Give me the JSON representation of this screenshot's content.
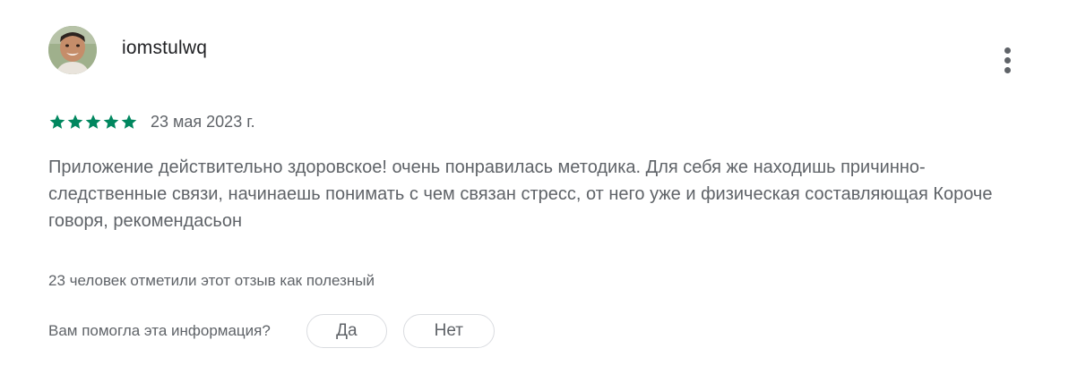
{
  "review": {
    "username": "iomstulwq",
    "rating": 5,
    "rating_max": 5,
    "date": "23 мая 2023 г.",
    "text": "Приложение действительно здоровское! очень понравилась методика. Для себя же находишь причинно-следственные связи, начинаешь понимать с чем связан стресс, от него уже и физическая составляющая Короче говоря, рекомендасьон",
    "helpful_count_text": "23 человек отметили этот отзыв как полезный",
    "feedback_question": "Вам помогла эта информация?",
    "yes_label": "Да",
    "no_label": "Нет"
  },
  "icons": {
    "more": "more-vertical-icon",
    "star": "star-icon"
  },
  "colors": {
    "star": "#01875f",
    "text": "#5f6368",
    "username": "#202124",
    "border": "#dadce0"
  }
}
